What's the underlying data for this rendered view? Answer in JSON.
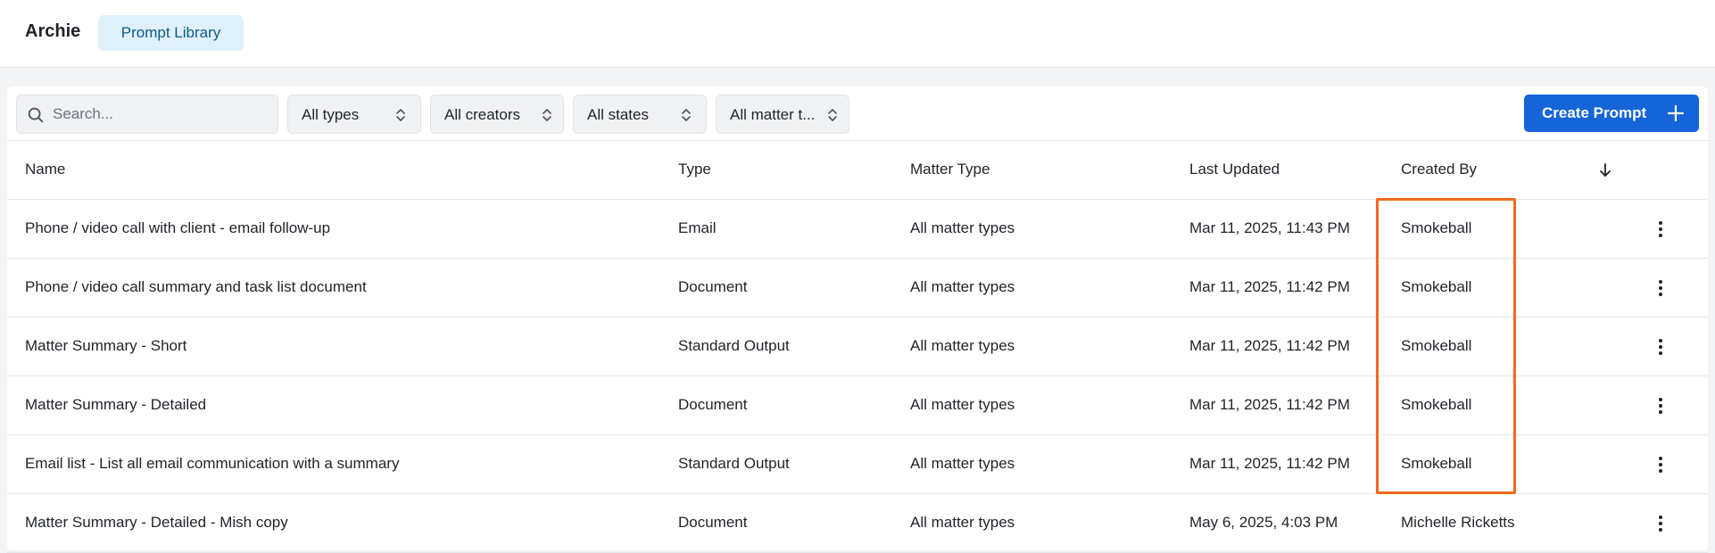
{
  "app": {
    "name": "Archie"
  },
  "nav": {
    "active_tab": "Prompt Library"
  },
  "filters": {
    "search_placeholder": "Search...",
    "types": "All types",
    "creators": "All creators",
    "states": "All states",
    "matter_types": "All matter t..."
  },
  "toolbar": {
    "create_label": "Create Prompt"
  },
  "table": {
    "columns": [
      "Name",
      "Type",
      "Matter Type",
      "Last Updated",
      "Created By"
    ],
    "rows": [
      {
        "name": "Phone / video call with client - email follow-up",
        "type": "Email",
        "matter_type": "All matter types",
        "last_updated": "Mar 11, 2025, 11:43 PM",
        "created_by": "Smokeball"
      },
      {
        "name": "Phone / video call summary and task list document",
        "type": "Document",
        "matter_type": "All matter types",
        "last_updated": "Mar 11, 2025, 11:42 PM",
        "created_by": "Smokeball"
      },
      {
        "name": "Matter Summary - Short",
        "type": "Standard Output",
        "matter_type": "All matter types",
        "last_updated": "Mar 11, 2025, 11:42 PM",
        "created_by": "Smokeball"
      },
      {
        "name": "Matter Summary - Detailed",
        "type": "Document",
        "matter_type": "All matter types",
        "last_updated": "Mar 11, 2025, 11:42 PM",
        "created_by": "Smokeball"
      },
      {
        "name": "Email list - List all email communication with a summary",
        "type": "Standard Output",
        "matter_type": "All matter types",
        "last_updated": "Mar 11, 2025, 11:42 PM",
        "created_by": "Smokeball"
      },
      {
        "name": "Matter Summary - Detailed - Mish copy",
        "type": "Document",
        "matter_type": "All matter types",
        "last_updated": "May 6, 2025, 4:03 PM",
        "created_by": "Michelle Ricketts"
      }
    ]
  },
  "icons": {
    "search": "search-icon",
    "chevron": "chevron-up-down-icon",
    "plus": "plus-icon",
    "sort": "arrow-down-icon",
    "more": "more-vertical-icon"
  },
  "colors": {
    "accent": "#1565d8",
    "nav_tab_bg": "#e0f0fb",
    "highlight": "#f26a1b"
  }
}
